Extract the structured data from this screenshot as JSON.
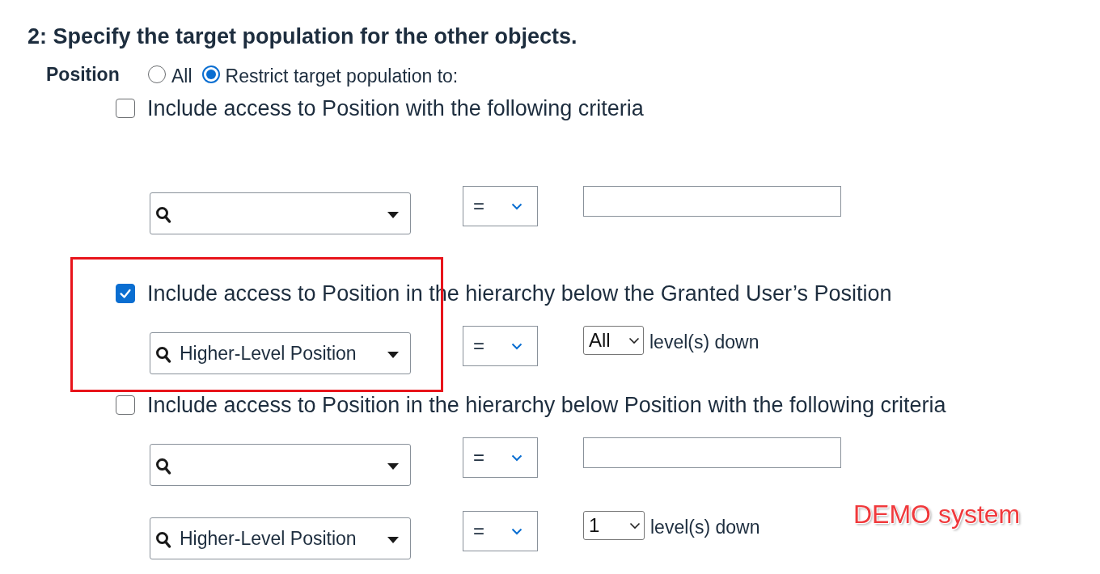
{
  "heading": "2: Specify the target population for the other objects.",
  "object_label": "Position",
  "radios": [
    {
      "label": "All",
      "selected": false
    },
    {
      "label": "Restrict target population to:",
      "selected": true
    }
  ],
  "sections": [
    {
      "label": "Include access to Position with the following criteria",
      "checked": false,
      "highlighted": false,
      "rows": [
        {
          "kind": "value",
          "operator": "="
        }
      ]
    },
    {
      "label": "Include access to Position in the hierarchy below the Granted User’s Position",
      "checked": true,
      "highlighted": true,
      "rows": [
        {
          "kind": "levels",
          "field": "Higher-Level Position",
          "operator": "=",
          "levels": "All",
          "suffix": "level(s) down"
        }
      ]
    },
    {
      "label": "Include access to Position in the hierarchy below Position with the following criteria",
      "checked": false,
      "highlighted": false,
      "rows": [
        {
          "kind": "value",
          "operator": "="
        },
        {
          "kind": "levels",
          "field": "Higher-Level Position",
          "operator": "=",
          "levels": "1",
          "suffix": "level(s) down"
        }
      ]
    }
  ],
  "annotation": "DEMO system"
}
